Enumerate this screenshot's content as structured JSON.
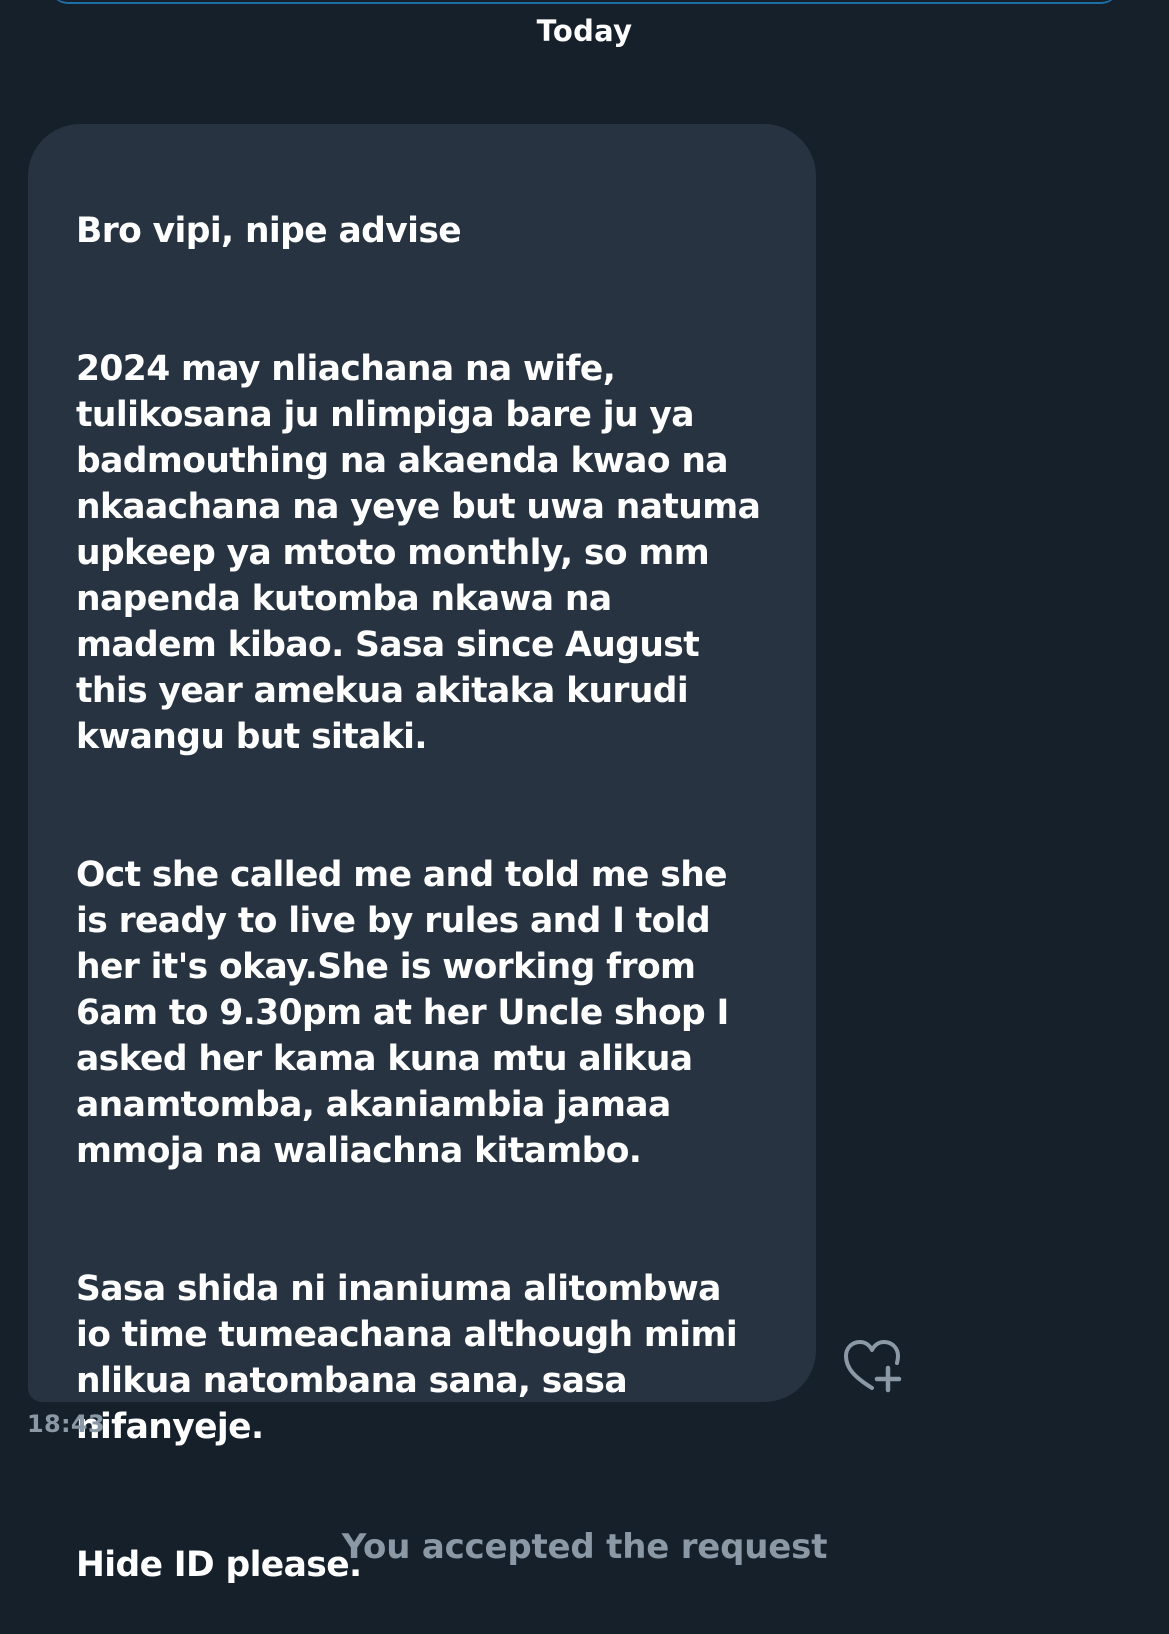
{
  "date_separator": "Today",
  "message": {
    "paragraphs": [
      "Bro vipi, nipe advise",
      "2024 may nliachana na wife,\ntulikosana ju nlimpiga bare ju ya\nbadmouthing na akaenda kwao na\nnkaachana na yeye but uwa natuma\nupkeep ya mtoto monthly, so mm\nnapenda kutomba nkawa na\nmadem kibao. Sasa since August\nthis year amekua akitaka kurudi\nkwangu  but sitaki.",
      "Oct she called me and told me she\nis ready to live by rules and I told\nher it's okay.She is working from\n6am to 9.30pm at her Uncle shop I\nasked her kama kuna mtu alikua\nanamtomba, akaniambia jamaa\nmmoja na waliachna kitambo.",
      "Sasa shida ni inaniuma alitombwa\nio time tumeachana although mimi\nnlikua natombana sana, sasa\nnifanyeje.",
      "Hide ID please."
    ],
    "timestamp": "18:43",
    "react_icon": "heart-plus-icon"
  },
  "system_notice": "You accepted the request",
  "colors": {
    "background": "#15202b",
    "bubble": "#273340",
    "text": "#ffffff",
    "muted": "#8b98a5",
    "accent_edge": "#1d6fa8"
  }
}
